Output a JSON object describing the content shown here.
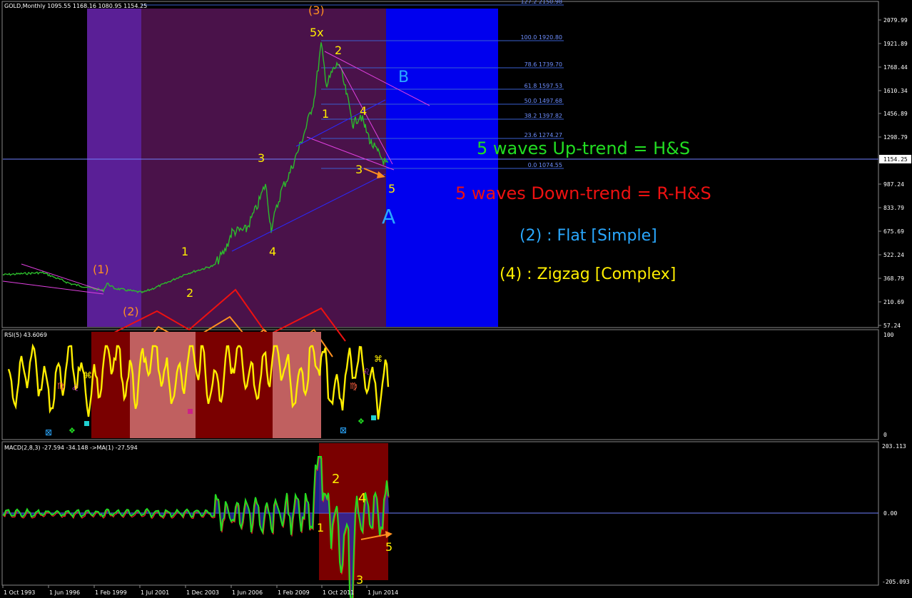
{
  "panels": {
    "main": {
      "header": "GOLD,Monthly  1095.55 1168.16 1080.95 1154.25"
    },
    "rsi": {
      "header": "RSI(5) 43.6069",
      "scale_max": "100",
      "scale_min": "0"
    },
    "macd": {
      "header": "MACD(2,8,3) -27.594 -34.148  ->MA(1) -27.594",
      "scale_max": "203.113",
      "scale_zero": "0.00",
      "scale_min": "-205.093"
    }
  },
  "price_axis": [
    "2079.99",
    "1921.89",
    "1768.44",
    "1610.34",
    "1456.89",
    "1298.79",
    "1154.25",
    "987.24",
    "833.79",
    "675.69",
    "522.24",
    "368.79",
    "210.69",
    "57.24"
  ],
  "fib_levels": [
    "127.2 2150.98",
    "100.0 1920.80",
    "78.6 1739.70",
    "61.8 1597.53",
    "50.0 1497.68",
    "38.2 1397.82",
    "23.6 1274.27",
    "0.0 1074.55"
  ],
  "time_axis": [
    "1 Oct 1993",
    "1 Jun 1996",
    "1 Feb 1999",
    "1 Jul 2001",
    "1 Dec 2003",
    "1 Jun 2006",
    "1 Feb 2009",
    "1 Oct 2011",
    "1 Jun 2014"
  ],
  "wave_labels": {
    "w3_big": "(3)",
    "w5x": "5x",
    "w1_paren": "(1)",
    "w2_paren": "(2)",
    "w1": "1",
    "w2": "2",
    "w3": "3",
    "w4": "4",
    "dn1": "1",
    "dn2": "2",
    "dn3": "3",
    "dn4": "4",
    "dn5": "5",
    "A": "A",
    "B": "B",
    "m1": "1",
    "m2": "2",
    "m3": "3",
    "m4": "4",
    "m5": "5"
  },
  "annotations": {
    "up_trend": "5 waves Up-trend  =  H&S",
    "down_trend": "5 waves Down-trend  =  R-H&S",
    "flat": "(2)  :  Flat  [Simple]",
    "zigzag": "(4)  :  Zigzag  [Complex]"
  },
  "symbols": {
    "virgo": "♍",
    "leo": "♌",
    "cmd": "⌘",
    "box": "⊠",
    "flower": "❖"
  },
  "colors": {
    "green": "#22dd22",
    "red": "#ee1111",
    "cyan": "#2aa8ff",
    "yellow": "#ffee00",
    "orange": "#ffa020",
    "blue": "#0000ee",
    "purple": "#5a1a7a",
    "darkred": "#7a0000",
    "pink": "#c06060"
  }
}
